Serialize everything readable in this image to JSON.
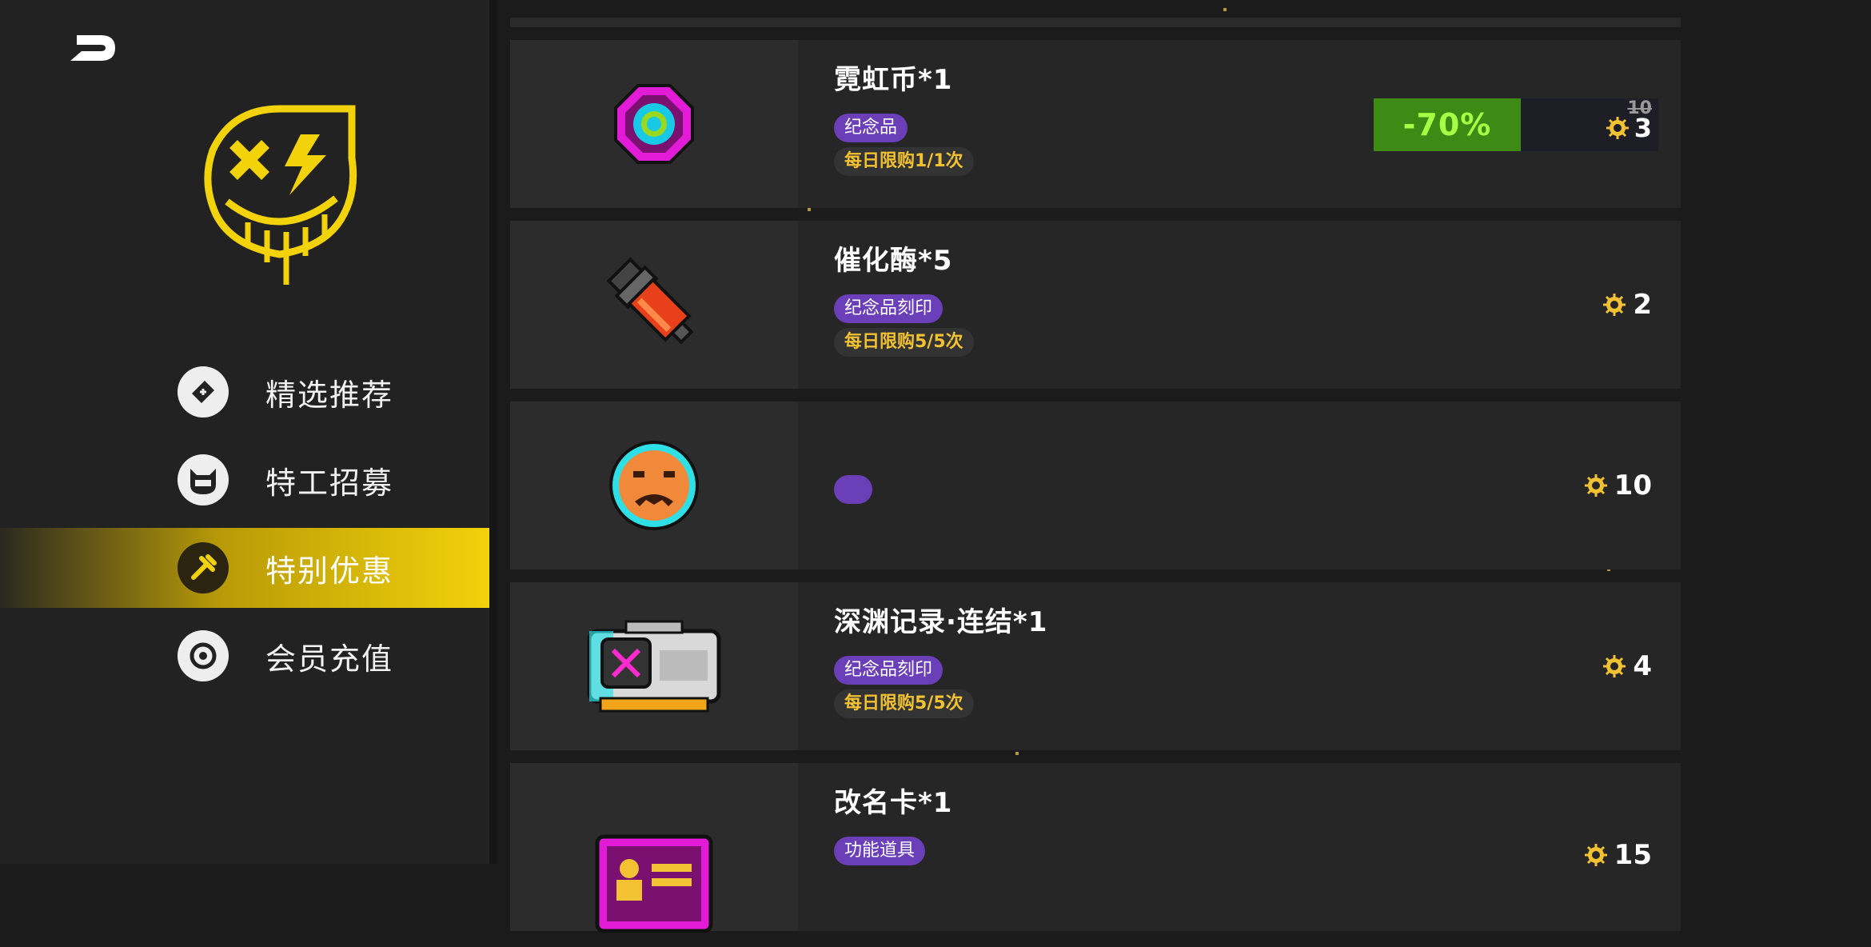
{
  "sidebar": {
    "nav": [
      {
        "label": "精选推荐",
        "icon": "ticket-icon",
        "active": false
      },
      {
        "label": "特工招募",
        "icon": "agent-mask-icon",
        "active": false
      },
      {
        "label": "特别优惠",
        "icon": "wrench-icon",
        "active": true
      },
      {
        "label": "会员充值",
        "icon": "target-coin-icon",
        "active": false
      }
    ]
  },
  "items": [
    {
      "title": "霓虹币*1",
      "tag": "纪念品",
      "limit": "每日限购1/1次",
      "icon": "neon-coin-icon",
      "discount": "-70%",
      "original_price": "10",
      "price": "3"
    },
    {
      "title": "催化酶*5",
      "tag": "纪念品刻印",
      "limit": "每日限购5/5次",
      "icon": "catalyst-tube-icon",
      "price": "2"
    },
    {
      "title": "",
      "tag": "",
      "limit": "",
      "icon": "orange-face-badge-icon",
      "price": "10"
    },
    {
      "title": "深渊记录·连结*1",
      "tag": "纪念品刻印",
      "limit": "每日限购5/5次",
      "icon": "abyss-record-cartridge-icon",
      "price": "4"
    },
    {
      "title": "改名卡*1",
      "tag": "功能道具",
      "limit": "",
      "icon": "rename-card-icon",
      "price": "15"
    }
  ],
  "colors": {
    "accent": "#f2d20a",
    "tag_purple": "#6b3fb8",
    "limit_yellow": "#f2c233",
    "discount_green": "#3d8a14"
  }
}
